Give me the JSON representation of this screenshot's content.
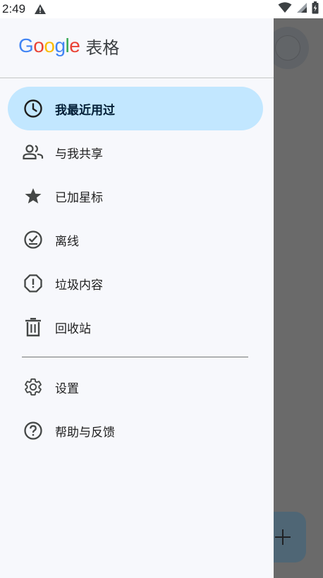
{
  "status_bar": {
    "time": "2:49"
  },
  "drawer": {
    "brand": {
      "google_letters": [
        {
          "ch": "G",
          "color": "#4285F4"
        },
        {
          "ch": "o",
          "color": "#EA4335"
        },
        {
          "ch": "o",
          "color": "#FBBC05"
        },
        {
          "ch": "g",
          "color": "#4285F4"
        },
        {
          "ch": "l",
          "color": "#34A853"
        },
        {
          "ch": "e",
          "color": "#EA4335"
        }
      ],
      "app_name": "表格"
    },
    "items": [
      {
        "label": "我最近用过",
        "icon": "clock-icon",
        "active": true
      },
      {
        "label": "与我共享",
        "icon": "people-icon",
        "active": false
      },
      {
        "label": "已加星标",
        "icon": "star-icon",
        "active": false
      },
      {
        "label": "离线",
        "icon": "offline-icon",
        "active": false
      },
      {
        "label": "垃圾内容",
        "icon": "spam-icon",
        "active": false
      },
      {
        "label": "回收站",
        "icon": "trash-icon",
        "active": false
      }
    ],
    "secondary_items": [
      {
        "label": "设置",
        "icon": "gear-icon"
      },
      {
        "label": "帮助与反馈",
        "icon": "help-icon"
      }
    ]
  },
  "colors": {
    "accent": "#c2e7ff",
    "drawer_bg": "#f7f8fc",
    "scrim": "#6b6b6b"
  }
}
